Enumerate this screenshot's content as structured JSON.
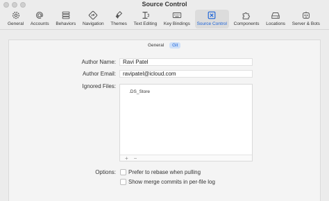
{
  "window": {
    "title": "Source Control"
  },
  "toolbar": {
    "items": [
      {
        "label": "General",
        "icon": "gear-icon"
      },
      {
        "label": "Accounts",
        "icon": "at-icon"
      },
      {
        "label": "Behaviors",
        "icon": "sliders-icon"
      },
      {
        "label": "Navigation",
        "icon": "compass-icon"
      },
      {
        "label": "Themes",
        "icon": "brush-icon"
      },
      {
        "label": "Text Editing",
        "icon": "text-cursor-icon"
      },
      {
        "label": "Key Bindings",
        "icon": "keyboard-icon"
      },
      {
        "label": "Source Control",
        "icon": "source-control-icon",
        "selected": true
      },
      {
        "label": "Components",
        "icon": "puzzle-icon"
      },
      {
        "label": "Locations",
        "icon": "drive-icon"
      },
      {
        "label": "Server & Bots",
        "icon": "robot-icon"
      }
    ]
  },
  "tabs": {
    "general": "General",
    "git": "Git",
    "selected": "Git"
  },
  "form": {
    "author_name_label": "Author Name:",
    "author_name_value": "Ravi Patel",
    "author_email_label": "Author Email:",
    "author_email_value": "ravipatel@icloud.com",
    "ignored_files_label": "Ignored Files:",
    "ignored_files": [
      ".DS_Store"
    ],
    "add_symbol": "+",
    "remove_symbol": "−",
    "options_label": "Options:",
    "options": [
      {
        "label": "Prefer to rebase when pulling",
        "checked": false
      },
      {
        "label": "Show merge commits in per-file log",
        "checked": false
      }
    ]
  },
  "colors": {
    "accent": "#1b63d8",
    "selected_tab_bg": "#cfe0f8"
  }
}
